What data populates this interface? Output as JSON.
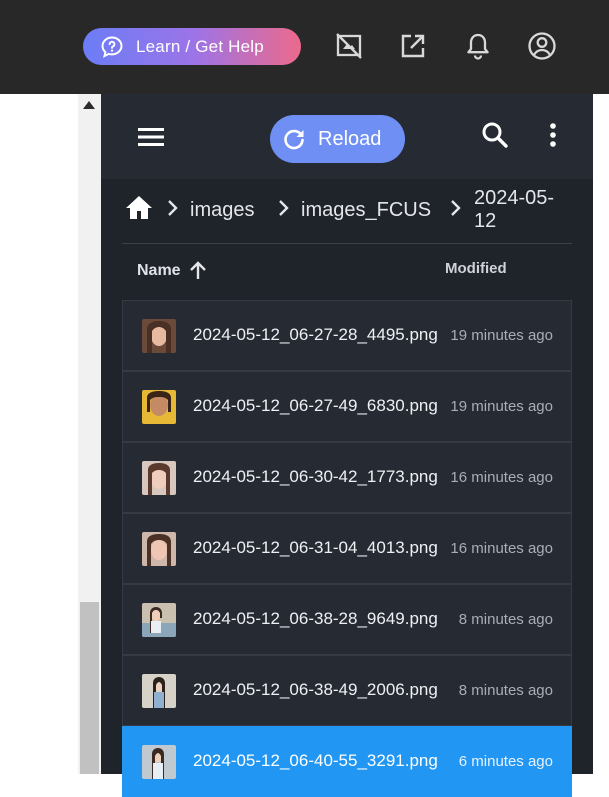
{
  "header": {
    "help_label": "Learn / Get Help",
    "icons": [
      "screen-off-icon",
      "open-external-icon",
      "bell-icon",
      "account-icon"
    ]
  },
  "toolbar": {
    "reload_label": "Reload"
  },
  "breadcrumb": {
    "items": [
      "images",
      "images_FCUS"
    ],
    "current": "2024-05-12"
  },
  "columns": {
    "name": "Name",
    "modified": "Modified"
  },
  "files": [
    {
      "name": "2024-05-12_06-27-28_4495.png",
      "modified": "19 minutes ago"
    },
    {
      "name": "2024-05-12_06-27-49_6830.png",
      "modified": "19 minutes ago"
    },
    {
      "name": "2024-05-12_06-30-42_1773.png",
      "modified": "16 minutes ago"
    },
    {
      "name": "2024-05-12_06-31-04_4013.png",
      "modified": "16 minutes ago"
    },
    {
      "name": "2024-05-12_06-38-28_9649.png",
      "modified": "8 minutes ago"
    },
    {
      "name": "2024-05-12_06-38-49_2006.png",
      "modified": "8 minutes ago"
    },
    {
      "name": "2024-05-12_06-40-55_3291.png",
      "modified": "6 minutes ago",
      "selected": true
    }
  ],
  "colors": {
    "header_bg": "#282828",
    "panel_bg": "#1f232a",
    "row_bg": "#262b33",
    "selected_row": "#2196f3",
    "reload_button": "#6f8ff5"
  }
}
